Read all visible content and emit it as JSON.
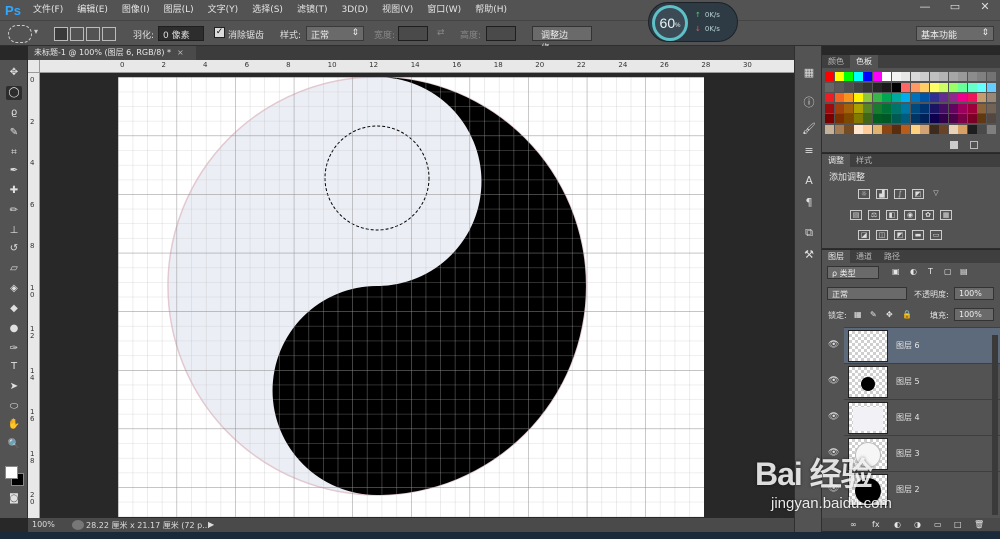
{
  "app": {
    "logo": "Ps"
  },
  "menu": [
    "文件(F)",
    "编辑(E)",
    "图像(I)",
    "图层(L)",
    "文字(Y)",
    "选择(S)",
    "滤镜(T)",
    "3D(D)",
    "视图(V)",
    "窗口(W)",
    "帮助(H)"
  ],
  "window_controls": {
    "minimize": "—",
    "maximize": "▭",
    "close": "✕"
  },
  "options": {
    "feather_label": "羽化:",
    "feather_value": "0 像素",
    "antialias_checked": true,
    "antialias_label": "消除锯齿",
    "style_label": "样式:",
    "style_value": "正常",
    "width_label": "宽度:",
    "height_label": "高度:",
    "refine_button": "调整边缘...",
    "workspace_value": "基本功能"
  },
  "gauge": {
    "percent": "60",
    "unit": "%",
    "up": "0K/s",
    "down": "0K/s"
  },
  "document": {
    "tab_title": "未标题-1 @ 100% (图层 6, RGB/8) *",
    "close": "×"
  },
  "ruler": {
    "top_labels": [
      "0",
      "2",
      "4",
      "6",
      "8",
      "10",
      "12",
      "14",
      "16",
      "18",
      "20",
      "22",
      "24",
      "26",
      "28",
      "30"
    ],
    "left_labels": [
      "0",
      "2",
      "4",
      "6",
      "8",
      "1 0",
      "1 2",
      "1 4",
      "1 6",
      "1 8",
      "2 0"
    ]
  },
  "status": {
    "zoom": "100%",
    "doc_size": "28.22 厘米 x 21.17 厘米 (72 p...",
    "arrow": "▶"
  },
  "swatches_panel": {
    "tabs": [
      "颜色",
      "色板"
    ],
    "active_tab": 1,
    "row1": [
      "#ff0000",
      "#ffff00",
      "#00ff00",
      "#00ffff",
      "#0000ff",
      "#ff00ff",
      "#ffffff",
      "#f2f2f2",
      "#e6e6e6",
      "#d9d9d9",
      "#cccccc",
      "#bfbfbf",
      "#b3b3b3",
      "#a6a6a6",
      "#999999",
      "#8c8c8c",
      "#808080",
      "#737373"
    ],
    "row2": [
      "#666666",
      "#595959",
      "#4d4d4d",
      "#404040",
      "#333333",
      "#262626",
      "#1a1a1a",
      "#000000",
      "#ff6666",
      "#ff9966",
      "#ffcc66",
      "#ffff66",
      "#ccff66",
      "#99ff66",
      "#66ff99",
      "#66ffcc",
      "#66ffff",
      "#66ccff"
    ],
    "row3": [
      "#ee1c24",
      "#f26522",
      "#f7941d",
      "#fff200",
      "#8dc63f",
      "#39b54a",
      "#00a651",
      "#00a99d",
      "#00aeef",
      "#0072bc",
      "#0054a6",
      "#2e3192",
      "#662d91",
      "#92278f",
      "#ec008c",
      "#ed145b",
      "#c69c6d",
      "#998675"
    ],
    "row4": [
      "#9e0b0f",
      "#a0410d",
      "#a36209",
      "#aba000",
      "#598527",
      "#197b30",
      "#007236",
      "#00746b",
      "#0076a3",
      "#004a80",
      "#003471",
      "#1b1464",
      "#440e62",
      "#630460",
      "#9e005d",
      "#9e0039",
      "#8c6239",
      "#736357"
    ],
    "row5": [
      "#790000",
      "#7b2e00",
      "#7d4900",
      "#827b00",
      "#406618",
      "#005e20",
      "#005826",
      "#005952",
      "#005b7f",
      "#003663",
      "#002157",
      "#0d004c",
      "#32004b",
      "#4b0049",
      "#7b0046",
      "#7a0026",
      "#603913",
      "#534741"
    ],
    "row6": [
      "#c7b299",
      "#a67c52",
      "#754c24",
      "#ffe6cc",
      "#ffcc99",
      "#e0b46e",
      "#8b4513",
      "#5a2d0c",
      "#b85c1c",
      "#ffd280",
      "#d4a373",
      "#3d2b1f",
      "#6b4226",
      "#e8d3b9",
      "#d9a066",
      "#1e1e1e",
      "#4a4a4a",
      "#7f7f7f"
    ]
  },
  "adjust_panel": {
    "tabs": [
      "调整",
      "样式"
    ],
    "active_tab": 0,
    "add_label": "添加调整"
  },
  "layers_panel": {
    "tabs": [
      "图层",
      "通道",
      "路径"
    ],
    "active_tab": 0,
    "kind_label": "ρ 类型",
    "blend_mode": "正常",
    "opacity_label": "不透明度:",
    "opacity_value": "100%",
    "lock_label": "锁定:",
    "fill_label": "填充:",
    "fill_value": "100%",
    "layers": [
      {
        "name": "图层 6",
        "selected": true,
        "thumb": "empty"
      },
      {
        "name": "图层 5",
        "selected": false,
        "thumb": "black-dot"
      },
      {
        "name": "图层 4",
        "selected": false,
        "thumb": "white-fill"
      },
      {
        "name": "图层 3",
        "selected": false,
        "thumb": "circle"
      },
      {
        "name": "图层 2",
        "selected": false,
        "thumb": "black-circle"
      }
    ],
    "footer_icons": [
      "∞",
      "fx",
      "◐",
      "◑",
      "▭",
      "□",
      "🗑"
    ]
  },
  "watermark": {
    "logo": "Bai 经验",
    "url": "jingyan.baidu.com"
  }
}
